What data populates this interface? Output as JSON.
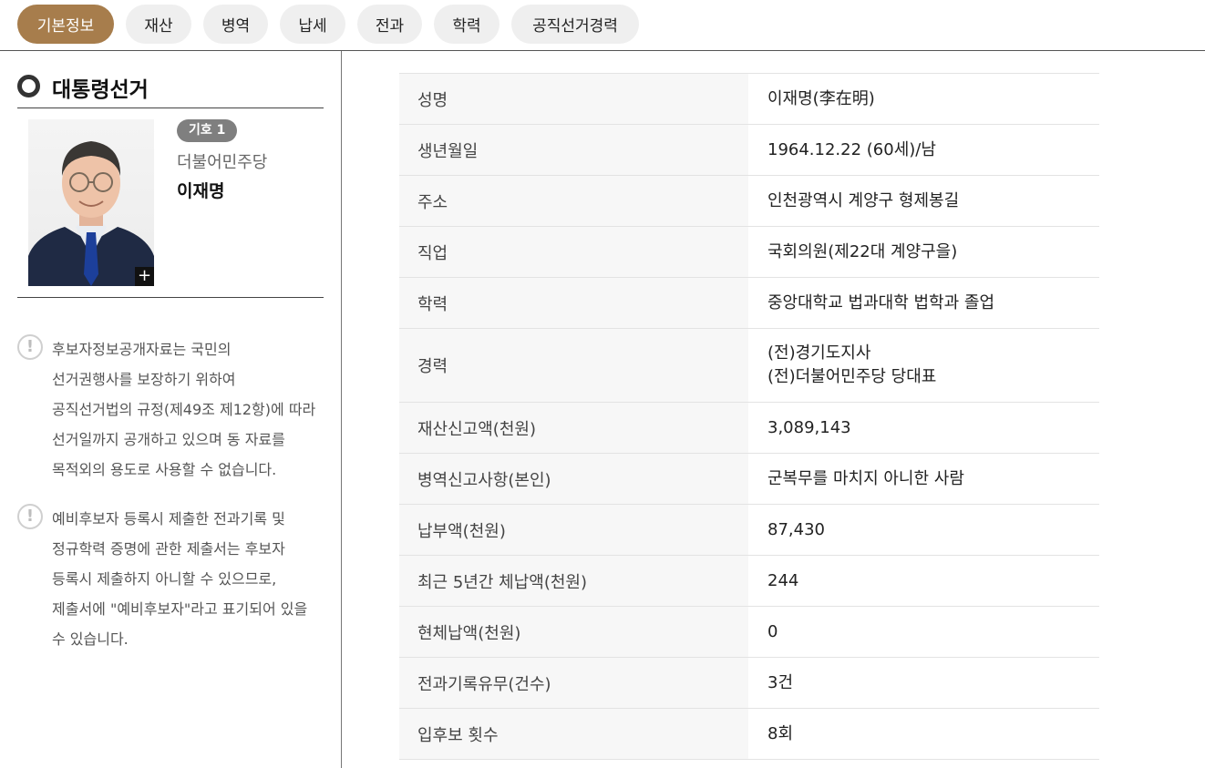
{
  "tabs": [
    {
      "label": "기본정보",
      "active": true
    },
    {
      "label": "재산",
      "active": false
    },
    {
      "label": "병역",
      "active": false
    },
    {
      "label": "납세",
      "active": false
    },
    {
      "label": "전과",
      "active": false
    },
    {
      "label": "학력",
      "active": false
    },
    {
      "label": "공직선거경력",
      "active": false
    }
  ],
  "section": {
    "title": "대통령선거"
  },
  "candidate": {
    "number_badge": "기호 1",
    "party": "더불어민주당",
    "name": "이재명",
    "zoom_icon": "+"
  },
  "notices": [
    {
      "icon": "!",
      "lines": [
        "후보자정보공개자료는 국민의",
        "선거권행사를 보장하기 위하여",
        "공직선거법의 규정(제49조 제12항)에 따라",
        "선거일까지 공개하고 있으며 동 자료를",
        "목적외의 용도로 사용할 수 없습니다."
      ]
    },
    {
      "icon": "!",
      "lines": [
        "예비후보자 등록시 제출한 전과기록 및",
        "정규학력 증명에 관한 제출서는 후보자",
        "등록시 제출하지 아니할 수 있으므로,",
        "제출서에 \"예비후보자\"라고 표기되어 있을",
        "수 있습니다."
      ]
    }
  ],
  "info": [
    {
      "label": "성명",
      "values": [
        "이재명(李在明)"
      ]
    },
    {
      "label": "생년월일",
      "values": [
        "1964.12.22 (60세)/남"
      ]
    },
    {
      "label": "주소",
      "values": [
        "인천광역시 계양구 형제봉길"
      ]
    },
    {
      "label": "직업",
      "values": [
        "국회의원(제22대 계양구을)"
      ]
    },
    {
      "label": "학력",
      "values": [
        "중앙대학교 법과대학 법학과 졸업"
      ]
    },
    {
      "label": "경력",
      "values": [
        "(전)경기도지사",
        "(전)더불어민주당 당대표"
      ]
    },
    {
      "label": "재산신고액(천원)",
      "values": [
        "3,089,143"
      ]
    },
    {
      "label": "병역신고사항(본인)",
      "values": [
        "군복무를 마치지 아니한 사람"
      ]
    },
    {
      "label": "납부액(천원)",
      "values": [
        "87,430"
      ]
    },
    {
      "label": "최근 5년간 체납액(천원)",
      "values": [
        "244"
      ]
    },
    {
      "label": "현체납액(천원)",
      "values": [
        "0"
      ]
    },
    {
      "label": "전과기록유무(건수)",
      "values": [
        "3건"
      ]
    },
    {
      "label": "입후보 횟수",
      "values": [
        "8회"
      ]
    }
  ]
}
